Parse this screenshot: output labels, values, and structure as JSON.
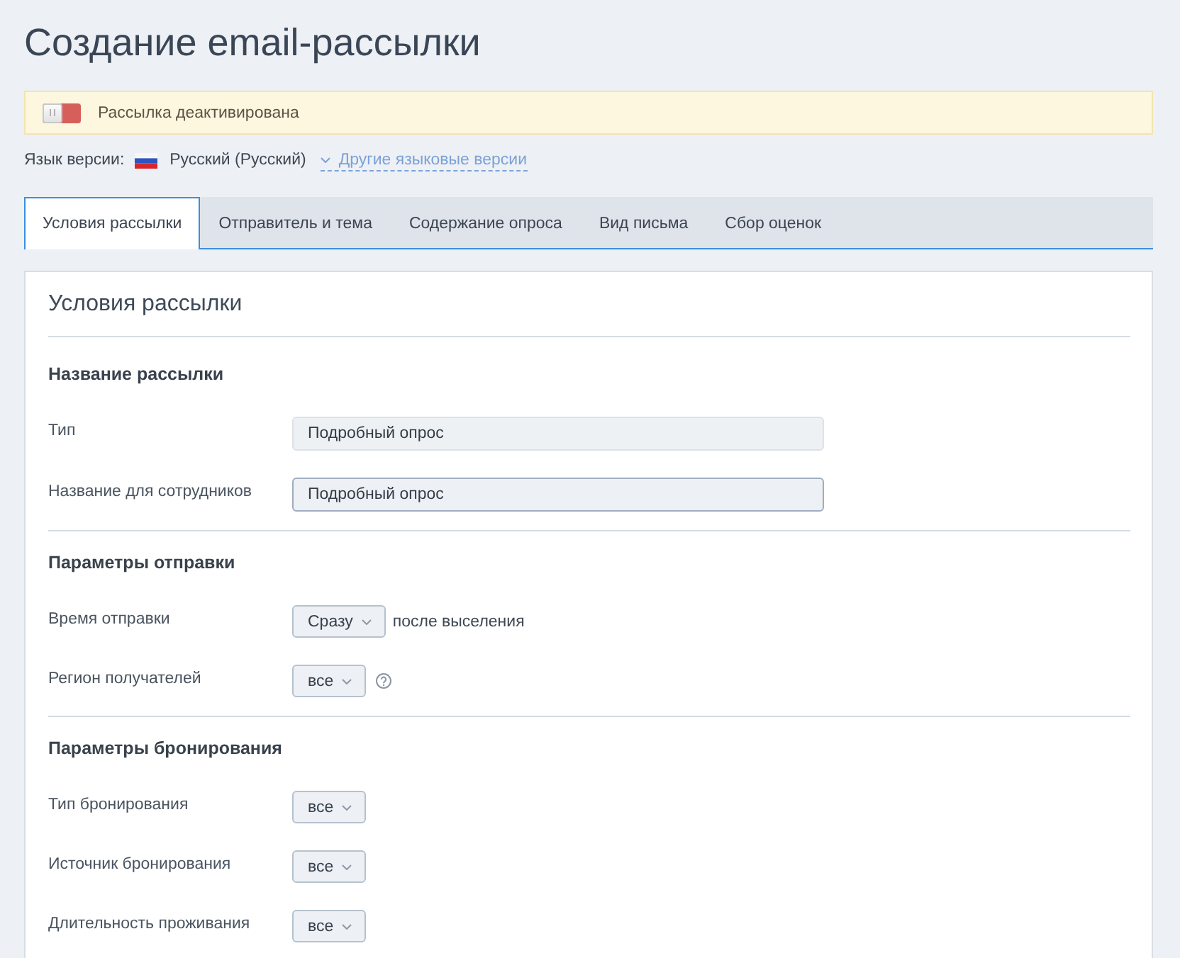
{
  "page": {
    "title": "Создание email-рассылки"
  },
  "status_banner": {
    "on": false,
    "text": "Рассылка деактивирована"
  },
  "language": {
    "label": "Язык версии:",
    "current": "Русский (Русский)",
    "other_link": "Другие языковые версии"
  },
  "tabs": [
    {
      "label": "Условия рассылки",
      "selected": true
    },
    {
      "label": "Отправитель и тема",
      "selected": false
    },
    {
      "label": "Содержание опроса",
      "selected": false
    },
    {
      "label": "Вид письма",
      "selected": false
    },
    {
      "label": "Сбор оценок",
      "selected": false
    }
  ],
  "panel": {
    "title": "Условия рассылки",
    "sections": [
      {
        "title": "Название рассылки",
        "rows": [
          {
            "label": "Тип",
            "kind": "text",
            "value": "Подробный опрос",
            "disabled": true
          },
          {
            "label": "Название для сотрудников",
            "kind": "text",
            "value": "Подробный опрос",
            "disabled": false
          }
        ]
      },
      {
        "title": "Параметры отправки",
        "rows": [
          {
            "label": "Время отправки",
            "kind": "select",
            "value": "Сразу",
            "suffix": "после выселения"
          },
          {
            "label": "Регион получателей",
            "kind": "select",
            "value": "все",
            "help": true
          }
        ]
      },
      {
        "title": "Параметры бронирования",
        "rows": [
          {
            "label": "Тип бронирования",
            "kind": "select",
            "value": "все"
          },
          {
            "label": "Источник бронирования",
            "kind": "select",
            "value": "все"
          },
          {
            "label": "Длительность проживания",
            "kind": "select",
            "value": "все"
          }
        ]
      }
    ]
  }
}
